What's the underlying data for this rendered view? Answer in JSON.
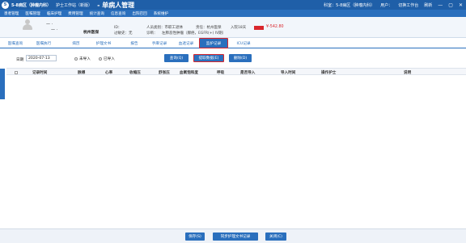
{
  "titlebar": {
    "logo": "5",
    "ward": "5-8病区（肿瘤内科）",
    "app_name": "护士工作站（新版）",
    "module_name": "- 单病人管理",
    "right": {
      "dept": "科室：5-8病区（肿瘤内科）",
      "user": "用户：",
      "switch": "切换工作台",
      "extra": "刷新"
    }
  },
  "menu": [
    "患者管理",
    "医嘱管理",
    "临床护理",
    "费用管理",
    "统计查询",
    "信息查询",
    "出院召回",
    "系统维护"
  ],
  "patient": {
    "name": "—  ·",
    "name2": "—  ·",
    "dept": "杭州医保",
    "info_row1": [
      "ID：",
      "人员类别：市职工退休",
      "责任：杭州医保",
      "入院18天"
    ],
    "info_row2": [
      "过敏史：无",
      "诊断：",
      "左肺恶性肿瘤（腺癌，EGFR(+) IV期）"
    ],
    "balance": "¥-542.80"
  },
  "tabs": [
    "医嘱查询",
    "医嘱执行",
    "病历",
    "护理文书",
    "报告",
    "手麻记录",
    "血透记录",
    "监护记录",
    "ICU记录"
  ],
  "active_tab": "监护记录",
  "toolbar": {
    "date_label": "日期",
    "date_value": "2020-07-13",
    "radio_unimported": "未导入",
    "radio_imported": "已导入",
    "query_btn": "查询(Q)",
    "fetch_btn": "提取数据(E)",
    "delete_btn": "删除(D)"
  },
  "table": {
    "columns": [
      "记录时间",
      "脉搏",
      "心率",
      "收缩压",
      "舒张压",
      "血氧饱和度",
      "呼吸",
      "是否导入",
      "导入时间",
      "操作护士",
      "说明"
    ]
  },
  "footer": {
    "save_btn": "保存(S)",
    "sync_btn": "同步护理文书记录",
    "close_btn": "关闭(C)"
  },
  "colors": {
    "primary": "#2a6fbd",
    "titlebar": "#1f5fa8",
    "highlight": "#d9262c"
  }
}
